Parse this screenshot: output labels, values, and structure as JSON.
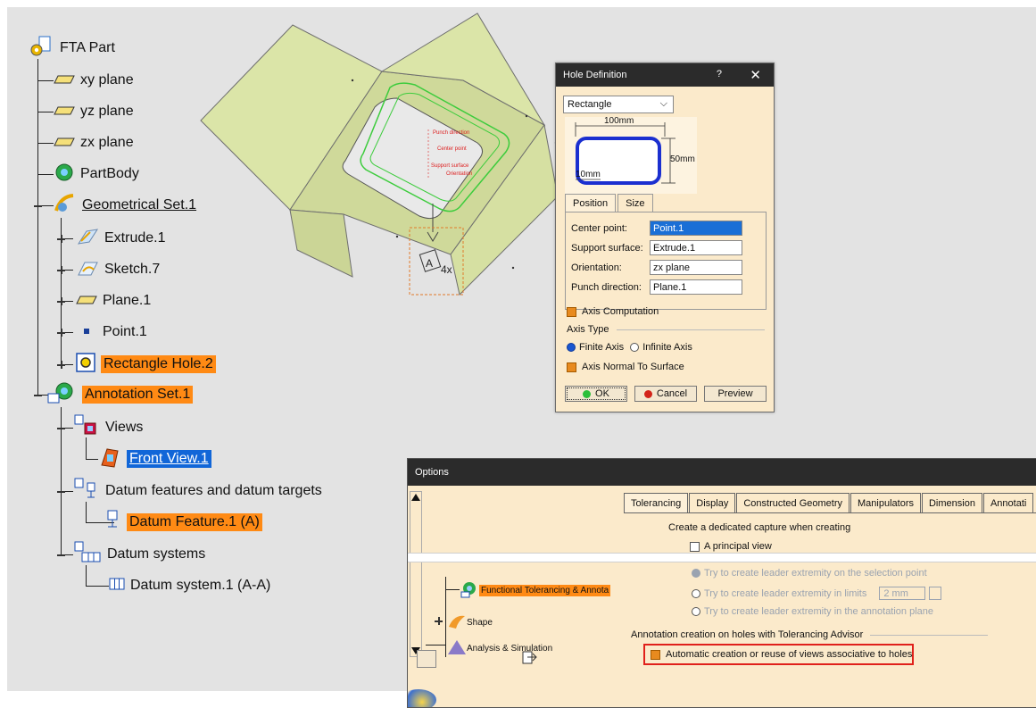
{
  "tree": {
    "root": "FTA Part",
    "items": [
      {
        "label": "xy plane",
        "icon": "plane-icon"
      },
      {
        "label": "yz plane",
        "icon": "plane-icon"
      },
      {
        "label": "zx plane",
        "icon": "plane-icon"
      },
      {
        "label": "PartBody",
        "icon": "part-body-icon"
      },
      {
        "label": "Geometrical Set.1",
        "icon": "geometrical-set-icon"
      },
      {
        "label": "Extrude.1",
        "icon": "extrude-icon"
      },
      {
        "label": "Sketch.7",
        "icon": "sketch-icon"
      },
      {
        "label": "Plane.1",
        "icon": "plane-icon"
      },
      {
        "label": "Point.1",
        "icon": "point-icon"
      },
      {
        "label": "Rectangle Hole.2",
        "icon": "hole-icon"
      },
      {
        "label": "Annotation Set.1",
        "icon": "annotation-set-icon"
      },
      {
        "label": "Views",
        "icon": "views-icon"
      },
      {
        "label": "Front View.1",
        "icon": "front-view-icon"
      },
      {
        "label": "Datum features and datum targets",
        "icon": "datum-features-icon"
      },
      {
        "label": "Datum Feature.1 (A)",
        "icon": "datum-feature-icon"
      },
      {
        "label": "Datum systems",
        "icon": "datum-systems-icon"
      },
      {
        "label": "Datum system.1 (A-A)",
        "icon": "datum-system-icon"
      }
    ]
  },
  "model": {
    "datum_label": "A",
    "count_label": "4x",
    "annotations": [
      "Punch direction",
      "Center point",
      "Support surface",
      "Orientation"
    ]
  },
  "hole_dialog": {
    "title": "Hole Definition",
    "help": "?",
    "close": "✕",
    "shape": "Rectangle",
    "dim_width": "100mm",
    "dim_height": "50mm",
    "dim_radius": "10mm",
    "tabs": [
      "Position",
      "Size"
    ],
    "fields": [
      {
        "label": "Center point:",
        "value": "Point.1"
      },
      {
        "label": "Support surface:",
        "value": "Extrude.1"
      },
      {
        "label": "Orientation:",
        "value": "zx plane"
      },
      {
        "label": "Punch direction:",
        "value": "Plane.1"
      }
    ],
    "axis_computation": "Axis Computation",
    "axis_type": "Axis Type",
    "finite_axis": "Finite Axis",
    "infinite_axis": "Infinite Axis",
    "axis_normal": "Axis Normal To Surface",
    "ok": "OK",
    "cancel": "Cancel",
    "preview": "Preview"
  },
  "options_dialog": {
    "title": "Options",
    "tabs": [
      "Tolerancing",
      "Display",
      "Constructed Geometry",
      "Manipulators",
      "Dimension",
      "Annotati"
    ],
    "left_items": [
      "Functional Tolerancing & Annota",
      "Shape",
      "Analysis & Simulation"
    ],
    "capture_text": "Create a dedicated capture when creating",
    "principal_view": "A principal view",
    "leader_selection": "Try to create leader extremity on the selection point",
    "leader_limits": "Try to create leader extremity in limits",
    "leader_limits_value": "2 mm",
    "leader_plane": "Try to create leader extremity in the annotation plane",
    "holes_section": "Annotation creation on holes with Tolerancing Advisor",
    "holes_option": "Automatic creation or reuse of views associative to holes"
  },
  "colors": {
    "highlight": "#ff8a14",
    "selection": "#1166d8",
    "dialog_bg": "#fbeacb",
    "titlebar": "#2b2b2b",
    "red_frame": "#e0201a"
  }
}
